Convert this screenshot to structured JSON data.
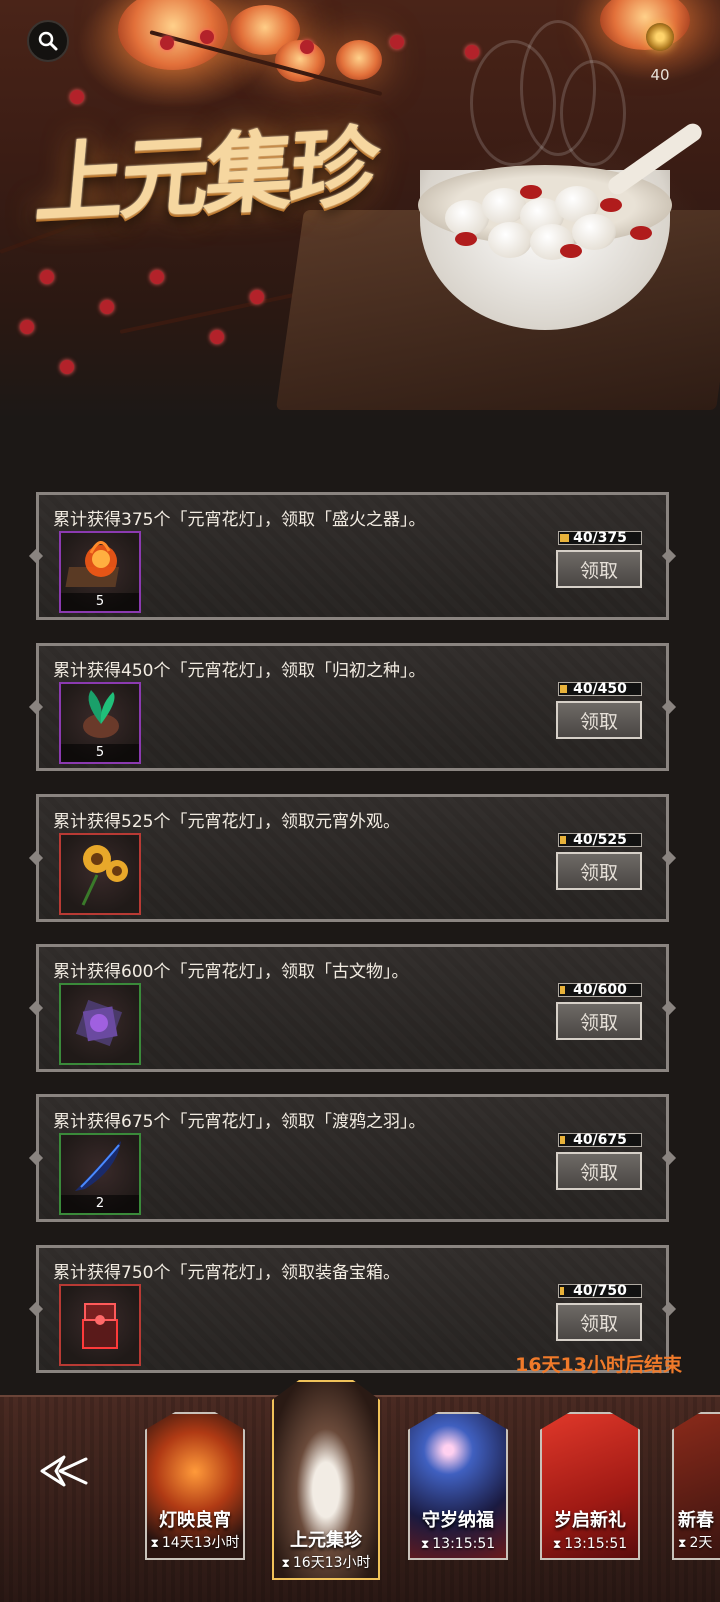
{
  "header": {
    "title": "上元集珍",
    "currency_count": "40"
  },
  "rewards": [
    {
      "title": "累计获得375个「元宵花灯」，领取「盛火之器」。",
      "progress": "40/375",
      "progress_fraction": 0.107,
      "claim_label": "领取",
      "item_count": "5",
      "item_icon": "flame-relic-icon",
      "rarity_color": "#8b3ab0"
    },
    {
      "title": "累计获得450个「元宵花灯」，领取「归初之种」。",
      "progress": "40/450",
      "progress_fraction": 0.089,
      "claim_label": "领取",
      "item_count": "5",
      "item_icon": "sprout-seed-icon",
      "rarity_color": "#8b3ab0"
    },
    {
      "title": "累计获得525个「元宵花灯」，领取元宵外观。",
      "progress": "40/525",
      "progress_fraction": 0.076,
      "claim_label": "领取",
      "item_count": "",
      "item_icon": "sunflower-icon",
      "rarity_color": "#b83a34"
    },
    {
      "title": "累计获得600个「元宵花灯」，领取「古文物」。",
      "progress": "40/600",
      "progress_fraction": 0.067,
      "claim_label": "领取",
      "item_count": "",
      "item_icon": "ancient-relic-icon",
      "rarity_color": "#3a8a3a"
    },
    {
      "title": "累计获得675个「元宵花灯」，领取「渡鸦之羽」。",
      "progress": "40/675",
      "progress_fraction": 0.059,
      "claim_label": "领取",
      "item_count": "2",
      "item_icon": "raven-feather-icon",
      "rarity_color": "#3a8a3a"
    },
    {
      "title": "累计获得750个「元宵花灯」，领取装备宝箱。",
      "progress": "40/750",
      "progress_fraction": 0.053,
      "claim_label": "领取",
      "item_count": "",
      "item_icon": "equipment-chest-icon",
      "rarity_color": "#b83a34"
    }
  ],
  "end_timer": "16天13小时后结束",
  "tabs": [
    {
      "label": "灯映良宵",
      "time": "14天13小时"
    },
    {
      "label": "上元集珍",
      "time": "16天13小时"
    },
    {
      "label": "守岁纳福",
      "time": "13:15:51"
    },
    {
      "label": "岁启新礼",
      "time": "13:15:51"
    },
    {
      "label": "新春",
      "time": "2天"
    }
  ],
  "colors": {
    "accent": "#f07a2a",
    "active_tab_border": "#f0c25a",
    "progress_fill": "#e8b23a"
  }
}
